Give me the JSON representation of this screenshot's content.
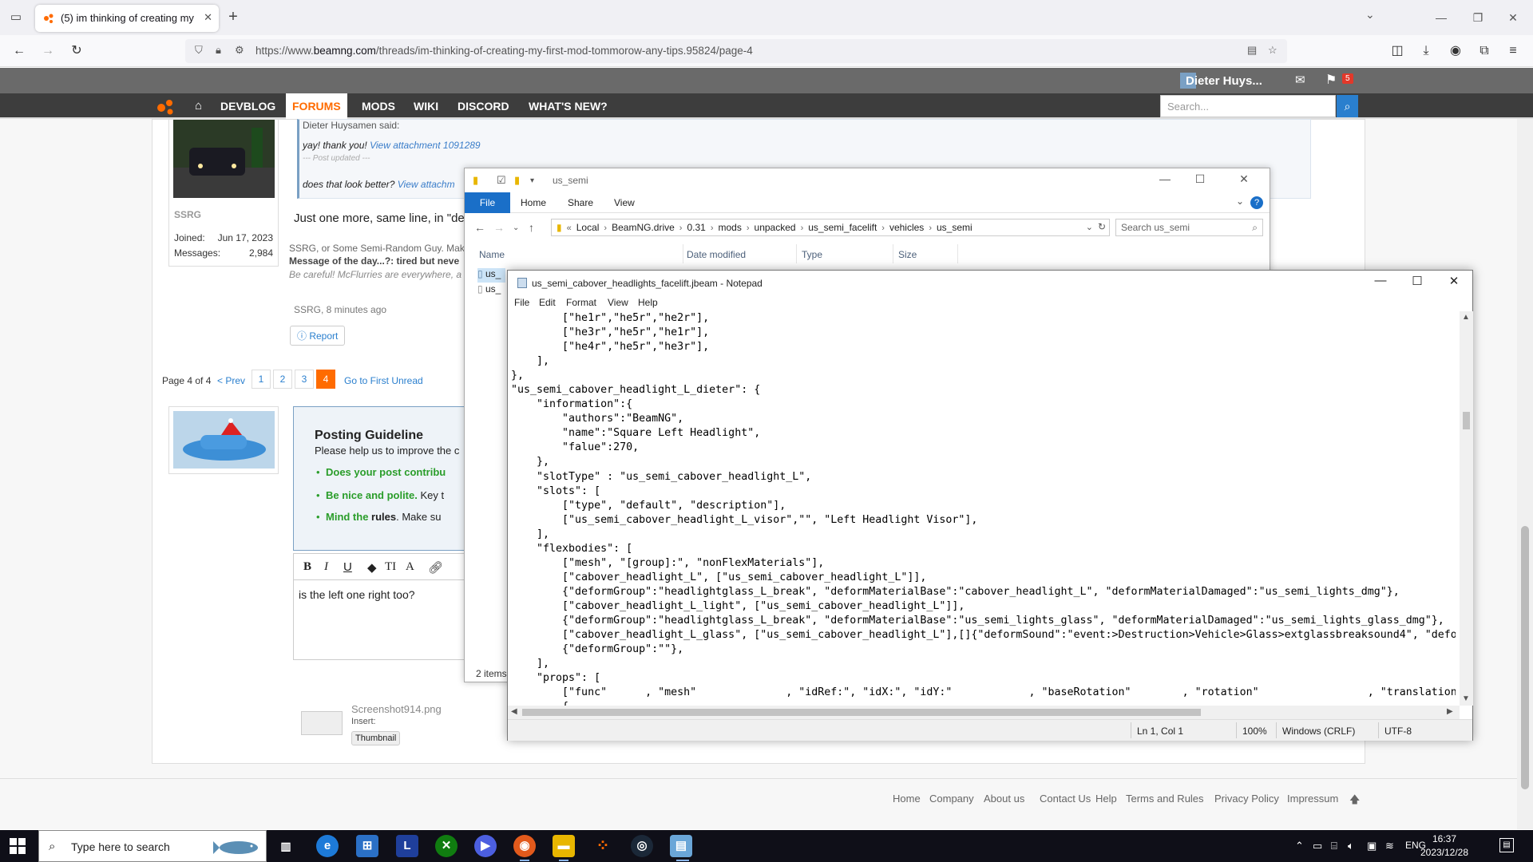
{
  "browser": {
    "tab_title": "(5) im thinking of creating my first mod tommorow any tips",
    "url_prefix": "https://www.",
    "url_domain": "beamng.com",
    "url_path": "/threads/im-thinking-of-creating-my-first-mod-tommorow-any-tips.95824/page-4"
  },
  "site": {
    "user_name": "Dieter Huys...",
    "alerts_count": "5",
    "nav": [
      "DEVBLOG",
      "FORUMS",
      "MODS",
      "WIKI",
      "DISCORD",
      "WHAT'S NEW?"
    ],
    "search_placeholder": "Search..."
  },
  "post": {
    "quote_author": "Dieter Huysamen said:",
    "quote_line1": "yay! thank you!",
    "quote_link1": "View attachment 1091289",
    "quote_updated": "--- Post updated ---",
    "quote_line2": "does that look better?",
    "quote_link2": "View attachm",
    "user_name": "SSRG",
    "joined_label": "Joined:",
    "joined_value": "Jun 17, 2023",
    "messages_label": "Messages:",
    "messages_value": "2,984",
    "body": "Just one more, same line, in \"de",
    "sig1": "SSRG, or Some Semi-Random Guy. Mak",
    "sig2": "Message of the day...?: tired but neve",
    "sig3": "Be careful! McFlurries are everywhere, a",
    "meta": "SSRG, 8 minutes ago",
    "report": "Report"
  },
  "pager": {
    "label": "Page 4 of 4",
    "prev": "< Prev",
    "pages": [
      "1",
      "2",
      "3",
      "4"
    ],
    "first_unread": "Go to First Unread"
  },
  "guideline": {
    "title": "Posting Guideline",
    "subtitle": "Please help us to improve the c",
    "item1_green": "Does your post contribu",
    "item1_rest": "",
    "item2_green": "Be nice and polite.",
    "item2_rest": " Key t",
    "item3_green": "Mind the",
    "item3_bold": " rules",
    "item3_rest": ". Make su"
  },
  "editor": {
    "text": "is the left one right too?"
  },
  "attachment": {
    "name": "Screenshot914.png",
    "insert": "Insert:",
    "thumbnail": "Thumbnail"
  },
  "footer": [
    "Home",
    "Company",
    "About us",
    "Contact Us",
    "Help",
    "Terms and Rules",
    "Privacy Policy",
    "Impressum"
  ],
  "explorer": {
    "title": "us_semi",
    "ribbon_tabs": [
      "Home",
      "Share",
      "View"
    ],
    "file_tab": "File",
    "breadcrumb": [
      "Local",
      "BeamNG.drive",
      "0.31",
      "mods",
      "unpacked",
      "us_semi_facelift",
      "vehicles",
      "us_semi"
    ],
    "search_placeholder": "Search us_semi",
    "columns": [
      "Name",
      "Date modified",
      "Type",
      "Size"
    ],
    "rows": [
      "us_",
      "us_"
    ],
    "item_count": "2 items"
  },
  "notepad": {
    "title": "us_semi_cabover_headlights_facelift.jbeam - Notepad",
    "menus": [
      "File",
      "Edit",
      "Format",
      "View",
      "Help"
    ],
    "lines": [
      "        [\"he1r\",\"he5r\",\"he2r\"],",
      "        [\"he3r\",\"he5r\",\"he1r\"],",
      "        [\"he4r\",\"he5r\",\"he3r\"],",
      "    ],",
      "},",
      "\"us_semi_cabover_headlight_L_dieter\": {",
      "    \"information\":{",
      "        \"authors\":\"BeamNG\",",
      "        \"name\":\"Square Left Headlight\",",
      "        \"falue\":270,",
      "    },",
      "    \"slotType\" : \"us_semi_cabover_headlight_L\",",
      "    \"slots\": [",
      "        [\"type\", \"default\", \"description\"],",
      "        [\"us_semi_cabover_headlight_L_visor\",\"\", \"Left Headlight Visor\"],",
      "    ],",
      "    \"flexbodies\": [",
      "        [\"mesh\", \"[group]:\", \"nonFlexMaterials\"],",
      "        [\"cabover_headlight_L\", [\"us_semi_cabover_headlight_L\"]],",
      "        {\"deformGroup\":\"headlightglass_L_break\", \"deformMaterialBase\":\"cabover_headlight_L\", \"deformMaterialDamaged\":\"us_semi_lights_dmg\"},",
      "        [\"cabover_headlight_L_light\", [\"us_semi_cabover_headlight_L\"]],",
      "        {\"deformGroup\":\"headlightglass_L_break\", \"deformMaterialBase\":\"us_semi_lights_glass\", \"deformMaterialDamaged\":\"us_semi_lights_glass_dmg\"},",
      "        [\"cabover_headlight_L_glass\", [\"us_semi_cabover_headlight_L\"],[]{\"deformSound\":\"event:>Destruction>Vehicle>Glass>extglassbreaksound4\", \"defo",
      "        {\"deformGroup\":\"\"},",
      "    ],",
      "    \"props\": [",
      "        [\"func\"      , \"mesh\"              , \"idRef:\", \"idX:\", \"idY:\"            , \"baseRotation\"        , \"rotation\"                 , \"translation",
      "        {"
    ],
    "status": {
      "position": "Ln 1, Col 1",
      "zoom": "100%",
      "eol": "Windows (CRLF)",
      "encoding": "UTF-8"
    }
  },
  "taskbar": {
    "search_placeholder": "Type here to search",
    "language": "ENG",
    "time": "16:37",
    "date": "2023/12/28"
  }
}
